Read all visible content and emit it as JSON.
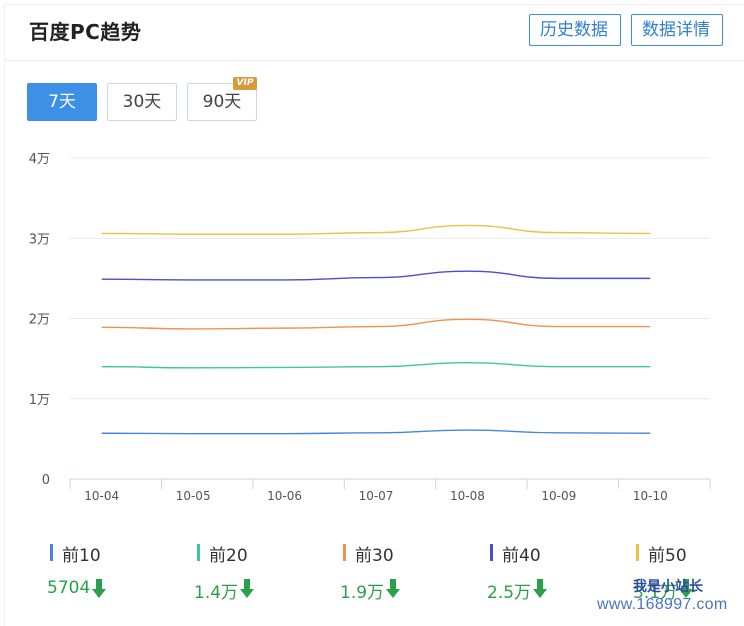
{
  "header": {
    "title": "百度PC趋势",
    "history_label": "历史数据",
    "detail_label": "数据详情"
  },
  "ranges": {
    "d7": "7天",
    "d30": "30天",
    "d90": "90天",
    "vip": "VIP",
    "active": "7天"
  },
  "chart_data": {
    "type": "line",
    "x": [
      "10-04",
      "10-05",
      "10-06",
      "10-07",
      "10-08",
      "10-09",
      "10-10"
    ],
    "y_ticks": [
      "0",
      "1万",
      "2万",
      "3万",
      "4万"
    ],
    "ylim": [
      0,
      40000
    ],
    "grid": true,
    "series": [
      {
        "name": "前10",
        "color": "#4a86d8",
        "values": [
          5700,
          5650,
          5650,
          5750,
          6100,
          5750,
          5704
        ]
      },
      {
        "name": "前20",
        "color": "#3cc8a0",
        "values": [
          14000,
          13850,
          13900,
          14000,
          14500,
          14000,
          14000
        ]
      },
      {
        "name": "前30",
        "color": "#f2924a",
        "values": [
          18900,
          18700,
          18800,
          19000,
          19900,
          19000,
          19000
        ]
      },
      {
        "name": "前40",
        "color": "#4a50c8",
        "values": [
          24900,
          24800,
          24800,
          25100,
          25900,
          25000,
          25000
        ]
      },
      {
        "name": "前50",
        "color": "#f0c040",
        "values": [
          30600,
          30500,
          30500,
          30700,
          31600,
          30700,
          30600
        ]
      }
    ]
  },
  "legend": [
    {
      "name": "前10",
      "value": "5704",
      "color": "#4a86d8",
      "trend": "down"
    },
    {
      "name": "前20",
      "value": "1.4万",
      "color": "#3cc8a0",
      "trend": "down"
    },
    {
      "name": "前30",
      "value": "1.9万",
      "color": "#f2924a",
      "trend": "down"
    },
    {
      "name": "前40",
      "value": "2.5万",
      "color": "#4a50c8",
      "trend": "down"
    },
    {
      "name": "前50",
      "value": "3.1万",
      "color": "#f0c040",
      "trend": "down"
    }
  ],
  "trend_color": "#2aa04a",
  "watermark": {
    "line1": "我是小站长",
    "line2": "www.168997.com"
  }
}
